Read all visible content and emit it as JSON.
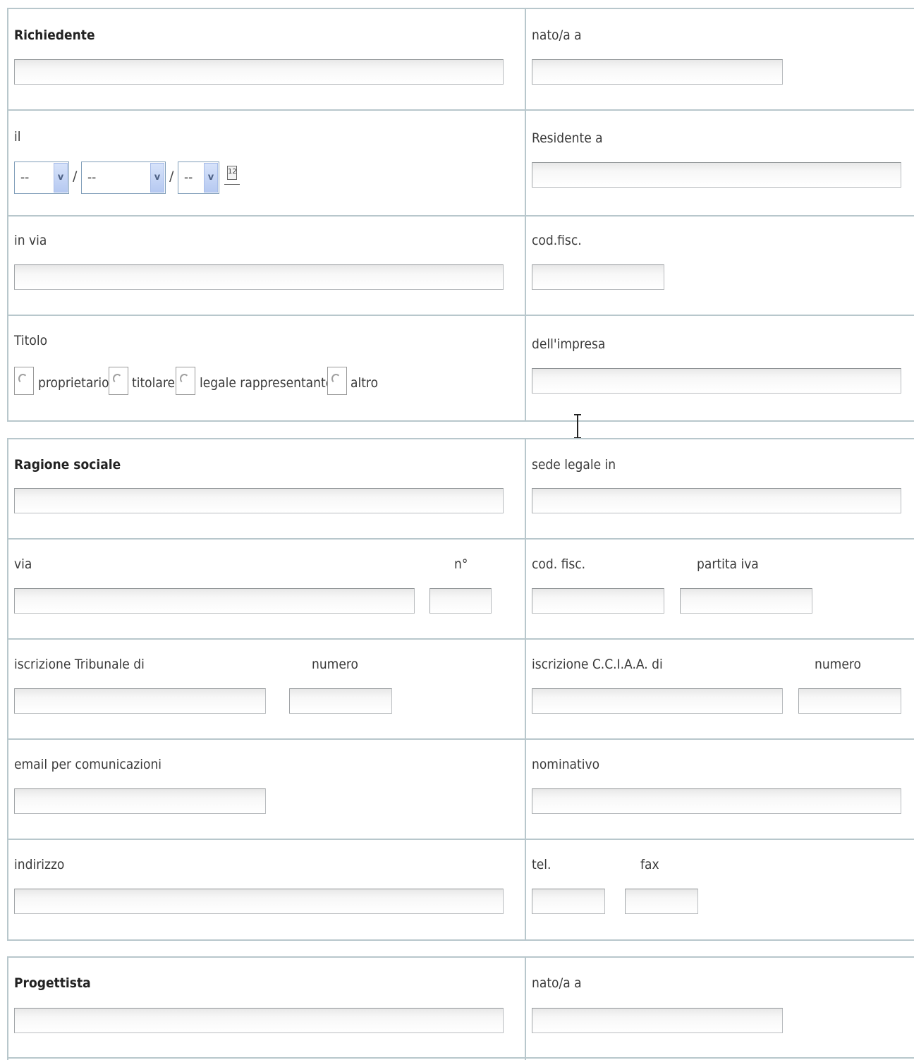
{
  "richiedente": {
    "title": "Richiedente",
    "nato_a": "nato/a a",
    "il": "il",
    "date_day": "--",
    "date_month": "--",
    "date_year": "--",
    "date_sep": "/",
    "calendar_icon": "calendar-icon",
    "residente_a": "Residente a",
    "in_via": "in via",
    "cod_fisc": "cod.fisc.",
    "titolo": "Titolo",
    "titolo_options": [
      "proprietario",
      "titolare",
      "legale rappresentante",
      "altro"
    ],
    "dell_impresa": "dell'impresa"
  },
  "impresa": {
    "ragione_sociale": "Ragione sociale",
    "sede_legale": "sede legale in",
    "via": "via",
    "numero_civico": "n°",
    "cod_fisc": "cod. fisc.",
    "partita_iva": "partita iva",
    "iscrizione_tribunale": "iscrizione Tribunale di",
    "numero_tribunale": "numero",
    "iscrizione_cciaa": "iscrizione C.C.I.A.A. di",
    "numero_cciaa": "numero",
    "email": "email per comunicazioni",
    "nominativo": "nominativo",
    "indirizzo": "indirizzo",
    "tel": "tel.",
    "fax": "fax"
  },
  "progettista": {
    "title": "Progettista",
    "nato_a": "nato/a a"
  }
}
